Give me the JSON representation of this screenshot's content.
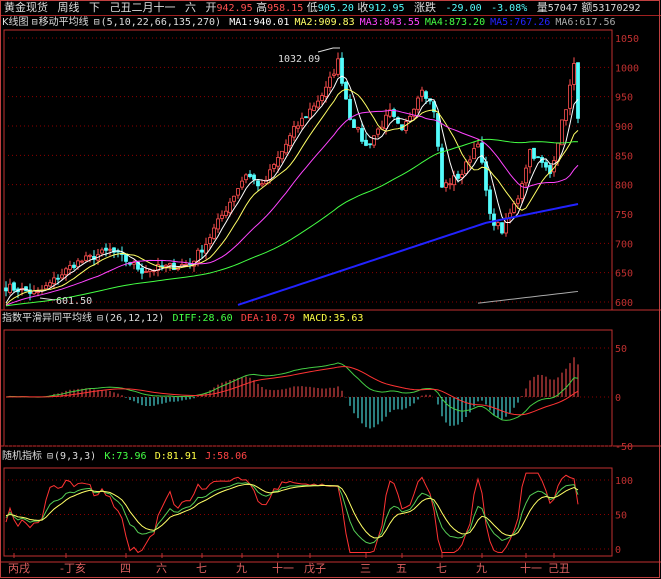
{
  "header": {
    "name": "黄金现货",
    "period": "周线",
    "dir": "下",
    "date": "己丑二月十一",
    "weekday": "六",
    "open_label": "开",
    "open": "942.95",
    "high_label": "高",
    "high": "958.15",
    "low_label": "低",
    "low": "905.20",
    "close_label": "收",
    "close": "912.95",
    "chg_label": "涨跌",
    "chg": "-29.00",
    "pct": "-3.08%",
    "vol_label": "量",
    "vol": "57047",
    "amt_label": "额",
    "amt": "53170292"
  },
  "main_panel": {
    "prefix": "K线图",
    "title": "移动平均线",
    "params": "(5,10,22,66,135,270)",
    "ma": [
      {
        "label": "MA1:940.01",
        "color": "#ffffff"
      },
      {
        "label": "MA2:909.83",
        "color": "#ffff66"
      },
      {
        "label": "MA3:843.55",
        "color": "#ff44ff"
      },
      {
        "label": "MA4:873.20",
        "color": "#44ff44"
      },
      {
        "label": "MA5:767.26",
        "color": "#2222ff"
      },
      {
        "label": "MA6:617.56",
        "color": "#aaaaaa"
      }
    ],
    "high_mark": "1032.09",
    "low_mark": "601.50"
  },
  "macd_panel": {
    "title": "指数平滑异同平均线",
    "params": "(26,12,12)",
    "diff": "DIFF:28.60",
    "dea": "DEA:10.79",
    "macd": "MACD:35.63"
  },
  "kdj_panel": {
    "title": "随机指标",
    "params": "(9,3,3)",
    "k": "K:73.96",
    "d": "D:81.91",
    "j": "J:58.06"
  },
  "colors": {
    "up": "#ff5050",
    "down": "#54fcfc",
    "grid": "#8b0000",
    "axis": "#c03030"
  },
  "chart_data": {
    "type": "candlestick",
    "title": "黄金现货 周线",
    "close_keypoints": [
      [
        0,
        626
      ],
      [
        8,
        614
      ],
      [
        17,
        665
      ],
      [
        26,
        688
      ],
      [
        34,
        654
      ],
      [
        46,
        665
      ],
      [
        50,
        700
      ],
      [
        60,
        819
      ],
      [
        64,
        796
      ],
      [
        72,
        893
      ],
      [
        80,
        962
      ],
      [
        83,
        1010
      ],
      [
        86,
        916
      ],
      [
        90,
        865
      ],
      [
        96,
        922
      ],
      [
        99,
        888
      ],
      [
        104,
        967
      ],
      [
        107,
        928
      ],
      [
        109,
        796
      ],
      [
        114,
        819
      ],
      [
        118,
        876
      ],
      [
        121,
        745
      ],
      [
        124,
        722
      ],
      [
        128,
        779
      ],
      [
        131,
        859
      ],
      [
        136,
        819
      ],
      [
        140,
        933
      ],
      [
        142,
        1001
      ],
      [
        143,
        913
      ]
    ],
    "ma5_keypoints": [
      [
        58,
        595
      ],
      [
        120,
        735
      ],
      [
        143,
        767
      ]
    ],
    "ma6_keypoints": [
      [
        118,
        598
      ],
      [
        143,
        618
      ]
    ],
    "ylim": [
      600,
      1050
    ],
    "yticks": [
      1050,
      1000,
      950,
      900,
      850,
      800,
      750,
      700,
      650,
      600
    ],
    "macd_ylim": [
      -50,
      50
    ],
    "macd_yticks": [
      50,
      0,
      -50
    ],
    "kdj_ylim": [
      0,
      100
    ],
    "kdj_yticks": [
      100,
      50,
      0
    ],
    "xticks": [
      {
        "i": 2,
        "label": "丙戌"
      },
      {
        "i": 15,
        "label": "-丁亥"
      },
      {
        "i": 30,
        "label": "四"
      },
      {
        "i": 39,
        "label": "六"
      },
      {
        "i": 49,
        "label": "七"
      },
      {
        "i": 59,
        "label": "九"
      },
      {
        "i": 68,
        "label": "十一"
      },
      {
        "i": 76,
        "label": "戊子"
      },
      {
        "i": 90,
        "label": "三"
      },
      {
        "i": 99,
        "label": "五"
      },
      {
        "i": 109,
        "label": "七"
      },
      {
        "i": 119,
        "label": "九"
      },
      {
        "i": 130,
        "label": "十一"
      },
      {
        "i": 137,
        "label": "己丑"
      }
    ]
  }
}
